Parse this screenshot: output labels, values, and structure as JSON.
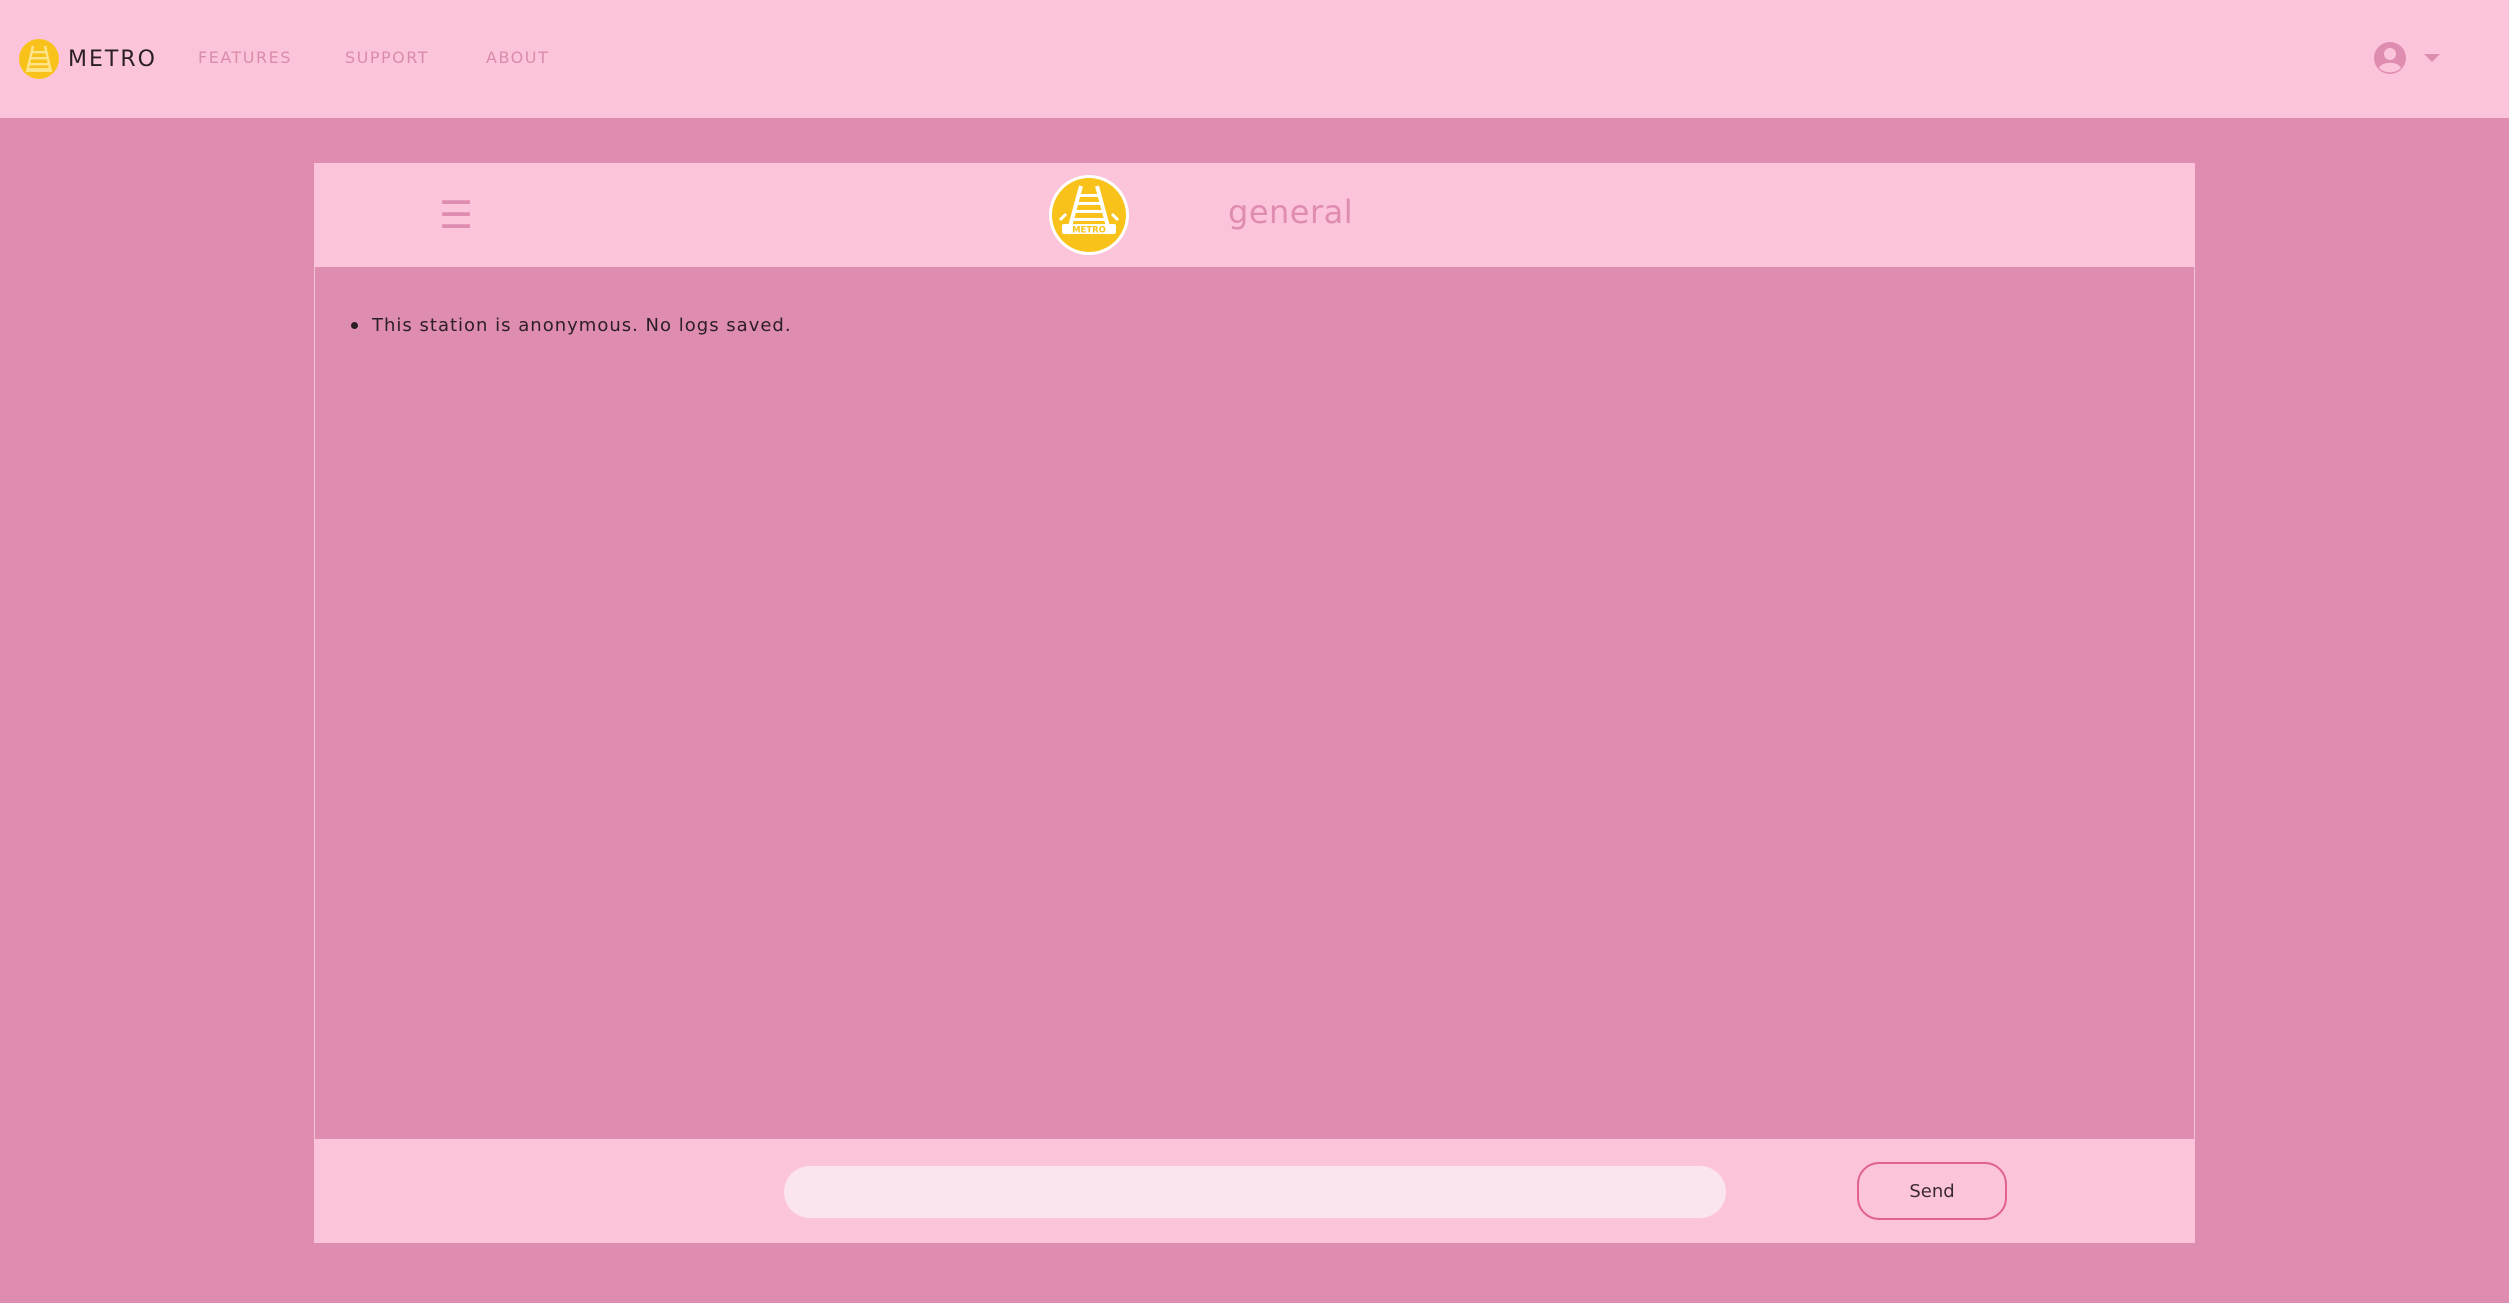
{
  "navbar": {
    "brand_name": "METRO",
    "logo_icon": "metro-tracks-logo-icon",
    "links": [
      {
        "label": "FEATURES"
      },
      {
        "label": "SUPPORT"
      },
      {
        "label": "ABOUT"
      }
    ],
    "user_icon": "user-circle-icon",
    "dropdown_icon": "caret-down-icon"
  },
  "chat": {
    "menu_icon": "hamburger-menu-icon",
    "header_logo_text": "METRO",
    "channel_name": "general",
    "messages": [
      {
        "text": "This station is anonymous. No logs saved."
      }
    ],
    "input": {
      "value": "",
      "placeholder": ""
    },
    "send_label": "Send"
  },
  "colors": {
    "background": "#df8cb1",
    "bar": "#fcc4da",
    "accent_pink": "#df8cb1",
    "logo_yellow": "#f8c21a",
    "send_border": "#e0608f",
    "input_bg": "#fae5ee"
  }
}
